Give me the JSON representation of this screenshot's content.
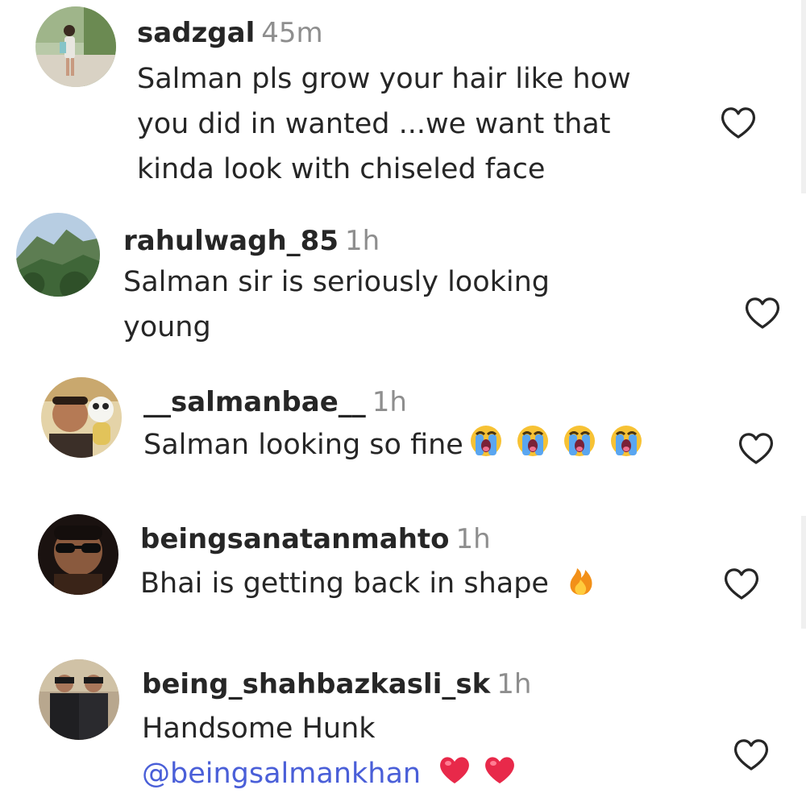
{
  "comments": [
    {
      "username": "sadzgal",
      "time": "45m",
      "lines": [
        "Salman pls grow your hair like how",
        "you did in wanted ...we want that",
        "kinda look with chiseled face"
      ]
    },
    {
      "username": "rahulwagh_85",
      "time": "1h",
      "lines": [
        "Salman sir is seriously looking",
        "young"
      ]
    },
    {
      "username": "__salmanbae__",
      "time": "1h",
      "lines": [
        "Salman looking so fine"
      ],
      "emoji": "loudly-crying-face-icon"
    },
    {
      "username": "beingsanatanmahto",
      "time": "1h",
      "lines": [
        "Bhai is getting back in shape"
      ],
      "emoji": "fire-icon"
    },
    {
      "username": "being_shahbazkasli_sk",
      "time": "1h",
      "lines": [
        "Handsome Hunk"
      ],
      "mention": "@beingsalmankhan",
      "emoji": "heart-icon"
    }
  ],
  "icons": {
    "like": "heart-outline-icon"
  },
  "colors": {
    "text": "#262626",
    "muted": "#8e8e8e",
    "mention": "#4a5fd8",
    "heart_emoji": "#e8294a"
  }
}
